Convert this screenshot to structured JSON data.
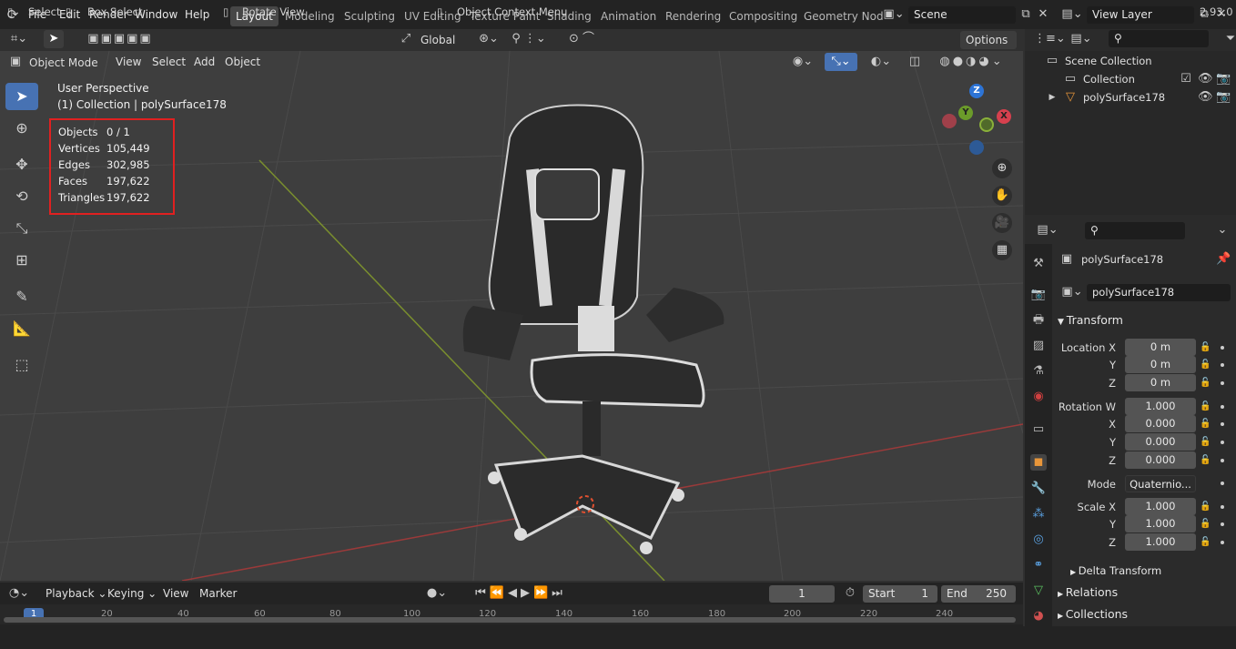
{
  "menu": {
    "file": "File",
    "edit": "Edit",
    "render": "Render",
    "window": "Window",
    "help": "Help"
  },
  "workspaces": [
    "Layout",
    "Modeling",
    "Sculpting",
    "UV Editing",
    "Texture Paint",
    "Shading",
    "Animation",
    "Rendering",
    "Compositing",
    "Geometry Nod"
  ],
  "scene": {
    "name": "Scene",
    "view_layer": "View Layer"
  },
  "tool_header": {
    "orientation": "Global",
    "options": "Options"
  },
  "viewport_header": {
    "mode": "Object Mode",
    "view": "View",
    "select": "Select",
    "add": "Add",
    "object": "Object"
  },
  "overlay": {
    "perspective": "User Perspective",
    "collection": "(1) Collection | polySurface178"
  },
  "stats": [
    {
      "label": "Objects",
      "value": "0 / 1"
    },
    {
      "label": "Vertices",
      "value": "105,449"
    },
    {
      "label": "Edges",
      "value": "302,985"
    },
    {
      "label": "Faces",
      "value": "197,622"
    },
    {
      "label": "Triangles",
      "value": "197,622"
    }
  ],
  "gizmo": {
    "z": "Z",
    "y": "Y",
    "x": "X"
  },
  "outliner": {
    "scene_collection": "Scene Collection",
    "collection": "Collection",
    "object": "polySurface178"
  },
  "properties": {
    "object_name": "polySurface178",
    "data_name": "polySurface178",
    "transform_title": "Transform",
    "location": {
      "x_label": "Location X",
      "y_label": "Y",
      "z_label": "Z",
      "x": "0 m",
      "y": "0 m",
      "z": "0 m"
    },
    "rotation": {
      "w_label": "Rotation W",
      "x_label": "X",
      "y_label": "Y",
      "z_label": "Z",
      "w": "1.000",
      "x": "0.000",
      "y": "0.000",
      "z": "0.000"
    },
    "mode_label": "Mode",
    "mode_value": "Quaternio...",
    "scale": {
      "x_label": "Scale X",
      "y_label": "Y",
      "z_label": "Z",
      "x": "1.000",
      "y": "1.000",
      "z": "1.000"
    },
    "delta_transform": "Delta Transform",
    "relations": "Relations",
    "collections": "Collections"
  },
  "timeline": {
    "playback": "Playback",
    "keying": "Keying",
    "view": "View",
    "marker": "Marker",
    "current_frame": "1",
    "start_label": "Start",
    "start": "1",
    "end_label": "End",
    "end": "250",
    "ruler": [
      "1",
      "20",
      "40",
      "60",
      "80",
      "100",
      "120",
      "140",
      "160",
      "180",
      "200",
      "220",
      "240"
    ]
  },
  "statusbar": {
    "select": "Select",
    "box_select": "Box Select",
    "rotate_view": "Rotate View",
    "context_menu": "Object Context Menu",
    "version": "2.93.0"
  }
}
